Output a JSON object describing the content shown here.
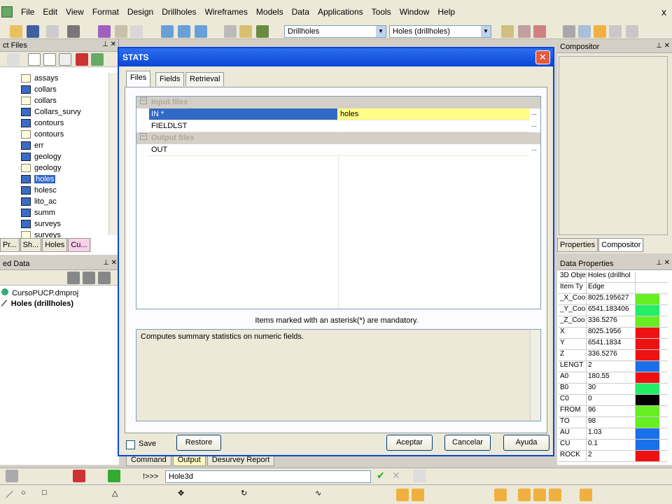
{
  "menu": {
    "items": [
      "File",
      "Edit",
      "View",
      "Format",
      "Design",
      "Drillholes",
      "Wireframes",
      "Models",
      "Data",
      "Applications",
      "Tools",
      "Window",
      "Help"
    ],
    "close": "x"
  },
  "toolbar": {
    "combo1": "Drillholes",
    "combo2": "Holes (drillholes)"
  },
  "project_files": {
    "title": "ct Files",
    "items": [
      {
        "label": "assays",
        "icon": "sheet"
      },
      {
        "label": "collars",
        "icon": "layer"
      },
      {
        "label": "collars",
        "icon": "sheet"
      },
      {
        "label": "Collars_survy",
        "icon": "layer"
      },
      {
        "label": "contours",
        "icon": "layer"
      },
      {
        "label": "contours",
        "icon": "sheet"
      },
      {
        "label": "err",
        "icon": "layer"
      },
      {
        "label": "geology",
        "icon": "layer"
      },
      {
        "label": "geology",
        "icon": "sheet"
      },
      {
        "label": "holes",
        "icon": "layer"
      },
      {
        "label": "holesc",
        "icon": "layer"
      },
      {
        "label": "lito_ac",
        "icon": "layer"
      },
      {
        "label": "summ",
        "icon": "layer"
      },
      {
        "label": "surveys",
        "icon": "layer"
      },
      {
        "label": "surveys",
        "icon": "sheet"
      }
    ],
    "tabs": [
      "Pr...",
      "Sh...",
      "Holes",
      "Cu..."
    ]
  },
  "loaded_data": {
    "title": "ed Data",
    "project": "CursoPUCP.dmproj",
    "object": "Holes (drillholes)"
  },
  "compositor": {
    "title": "Compositor",
    "tabs": [
      "Properties",
      "Compositor"
    ]
  },
  "data_properties": {
    "title": "Data Properties",
    "rows": [
      {
        "k": "3D Obje",
        "v": "Holes (drillhol",
        "c": "#ffffff"
      },
      {
        "k": "Item Ty",
        "v": "Edge",
        "c": "#ffffff"
      },
      {
        "k": "_X_Coo",
        "v": "8025.195627",
        "c": "#66ee22"
      },
      {
        "k": "_Y_Coo",
        "v": "6541.183406",
        "c": "#22ee66"
      },
      {
        "k": "_Z_Coo",
        "v": "336.5276",
        "c": "#66ee22"
      },
      {
        "k": "X",
        "v": "8025.1956",
        "c": "#ee1111"
      },
      {
        "k": "Y",
        "v": "6541.1834",
        "c": "#ee1111"
      },
      {
        "k": "Z",
        "v": "336.5276",
        "c": "#ee1111"
      },
      {
        "k": "LENGT",
        "v": "2",
        "c": "#1a70e8"
      },
      {
        "k": "A0",
        "v": "180.55",
        "c": "#ee1111"
      },
      {
        "k": "B0",
        "v": "30",
        "c": "#22ee66"
      },
      {
        "k": "C0",
        "v": "0",
        "c": "#000000"
      },
      {
        "k": "FROM",
        "v": "96",
        "c": "#66ee22"
      },
      {
        "k": "TO",
        "v": "98",
        "c": "#66ee22"
      },
      {
        "k": "AU",
        "v": "1.03",
        "c": "#1a70e8"
      },
      {
        "k": "CU",
        "v": "0.1",
        "c": "#1a70e8"
      },
      {
        "k": "ROCK",
        "v": "2",
        "c": "#ee1111"
      }
    ]
  },
  "output_tabs": [
    "Command",
    "Output",
    "Desurvey Report"
  ],
  "cmdbar": {
    "prompt": "!>>>",
    "value": "Hole3d"
  },
  "dialog": {
    "title": "STATS",
    "close": "✕",
    "tabs": [
      "Files",
      "Fields",
      "Retrieval"
    ],
    "grid": {
      "input_header": "Input files",
      "output_header": "Output files",
      "rows": [
        {
          "name": "IN *",
          "value": "holes",
          "dots": "..."
        },
        {
          "name": "FIELDLST",
          "value": "",
          "dots": "..."
        },
        {
          "name": "OUT",
          "value": "",
          "dots": "..."
        }
      ]
    },
    "mandatory_note": "Items marked with an asterisk(*) are mandatory.",
    "description": "Computes summary statistics on numeric fields.",
    "save_label": "Save",
    "buttons": {
      "restore": "Restore",
      "ok": "Aceptar",
      "cancel": "Cancelar",
      "help": "Ayuda"
    }
  }
}
